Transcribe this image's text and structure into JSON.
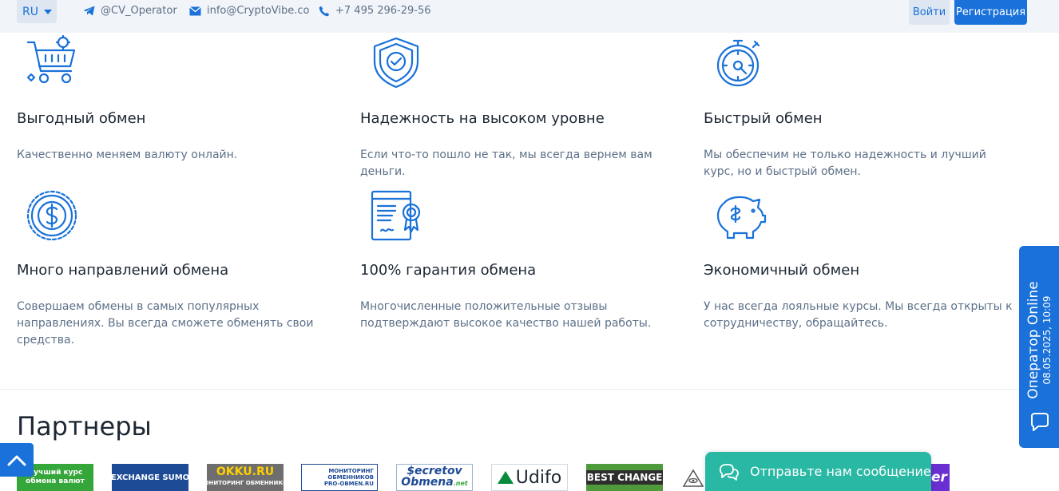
{
  "topbar": {
    "lang": "RU",
    "telegram": "@CV_Operator",
    "email": "info@CryptoVibe.co",
    "phone": "+7 495 296-29-56",
    "login": "Войти",
    "register": "Регистрация"
  },
  "features": [
    {
      "icon": "cart-icon",
      "title": "Выгодный обмен",
      "text": "Качественно меняем валюту онлайн."
    },
    {
      "icon": "shield-icon",
      "title": "Надежность на высоком уровне",
      "text": "Если что-то пошло не так, мы всегда вернем вам деньги."
    },
    {
      "icon": "stopwatch-icon",
      "title": "Быстрый обмен",
      "text": "Мы обеспечим не только надежность и лучший курс, но и быстрый обмен."
    },
    {
      "icon": "coin-icon",
      "title": "Много направлений обмена",
      "text": "Совершаем обмены в самых популярных направлениях. Вы всегда сможете обменять свои средства."
    },
    {
      "icon": "certificate-icon",
      "title": "100% гарантия обмена",
      "text": "Многочисленные положительные отзывы подтверждают высокое качество нашей работы."
    },
    {
      "icon": "piggy-bank-icon",
      "title": "Экономичный обмен",
      "text": "У нас всегда лояльные курсы. Мы всегда открыты к сотрудничеству, обращайтесь."
    }
  ],
  "partners": {
    "title": "Партнеры",
    "logos": [
      {
        "line1": "Лучший курс",
        "line2": "обмена валют"
      },
      {
        "text": "EXCHANGE SUMO"
      },
      {
        "line1": "OKKU.RU",
        "line2": "МОНИТОРИНГ ОБМЕННИКОВ"
      },
      {
        "line1": "МОНИТОРИНГ",
        "line2": "ОБМЕННИКОВ",
        "line3": "PRO-OBMEN.RU"
      },
      {
        "line1": "$ecretov",
        "line2": "Obmena",
        "sup": ".net"
      },
      {
        "text": "Udifo"
      },
      {
        "text": "BEST CHANGE"
      },
      {
        "text": "er"
      }
    ]
  },
  "operator": {
    "title": "Оператор Online",
    "time": "08.05.2025, 10:09"
  },
  "chat": {
    "label": "Отправьте нам сообщение"
  },
  "colors": {
    "accent": "#1971d9",
    "chat": "#29b8a4",
    "text": "#1d2733",
    "muted": "#5c7088",
    "topbar": "#f1f4f9"
  }
}
